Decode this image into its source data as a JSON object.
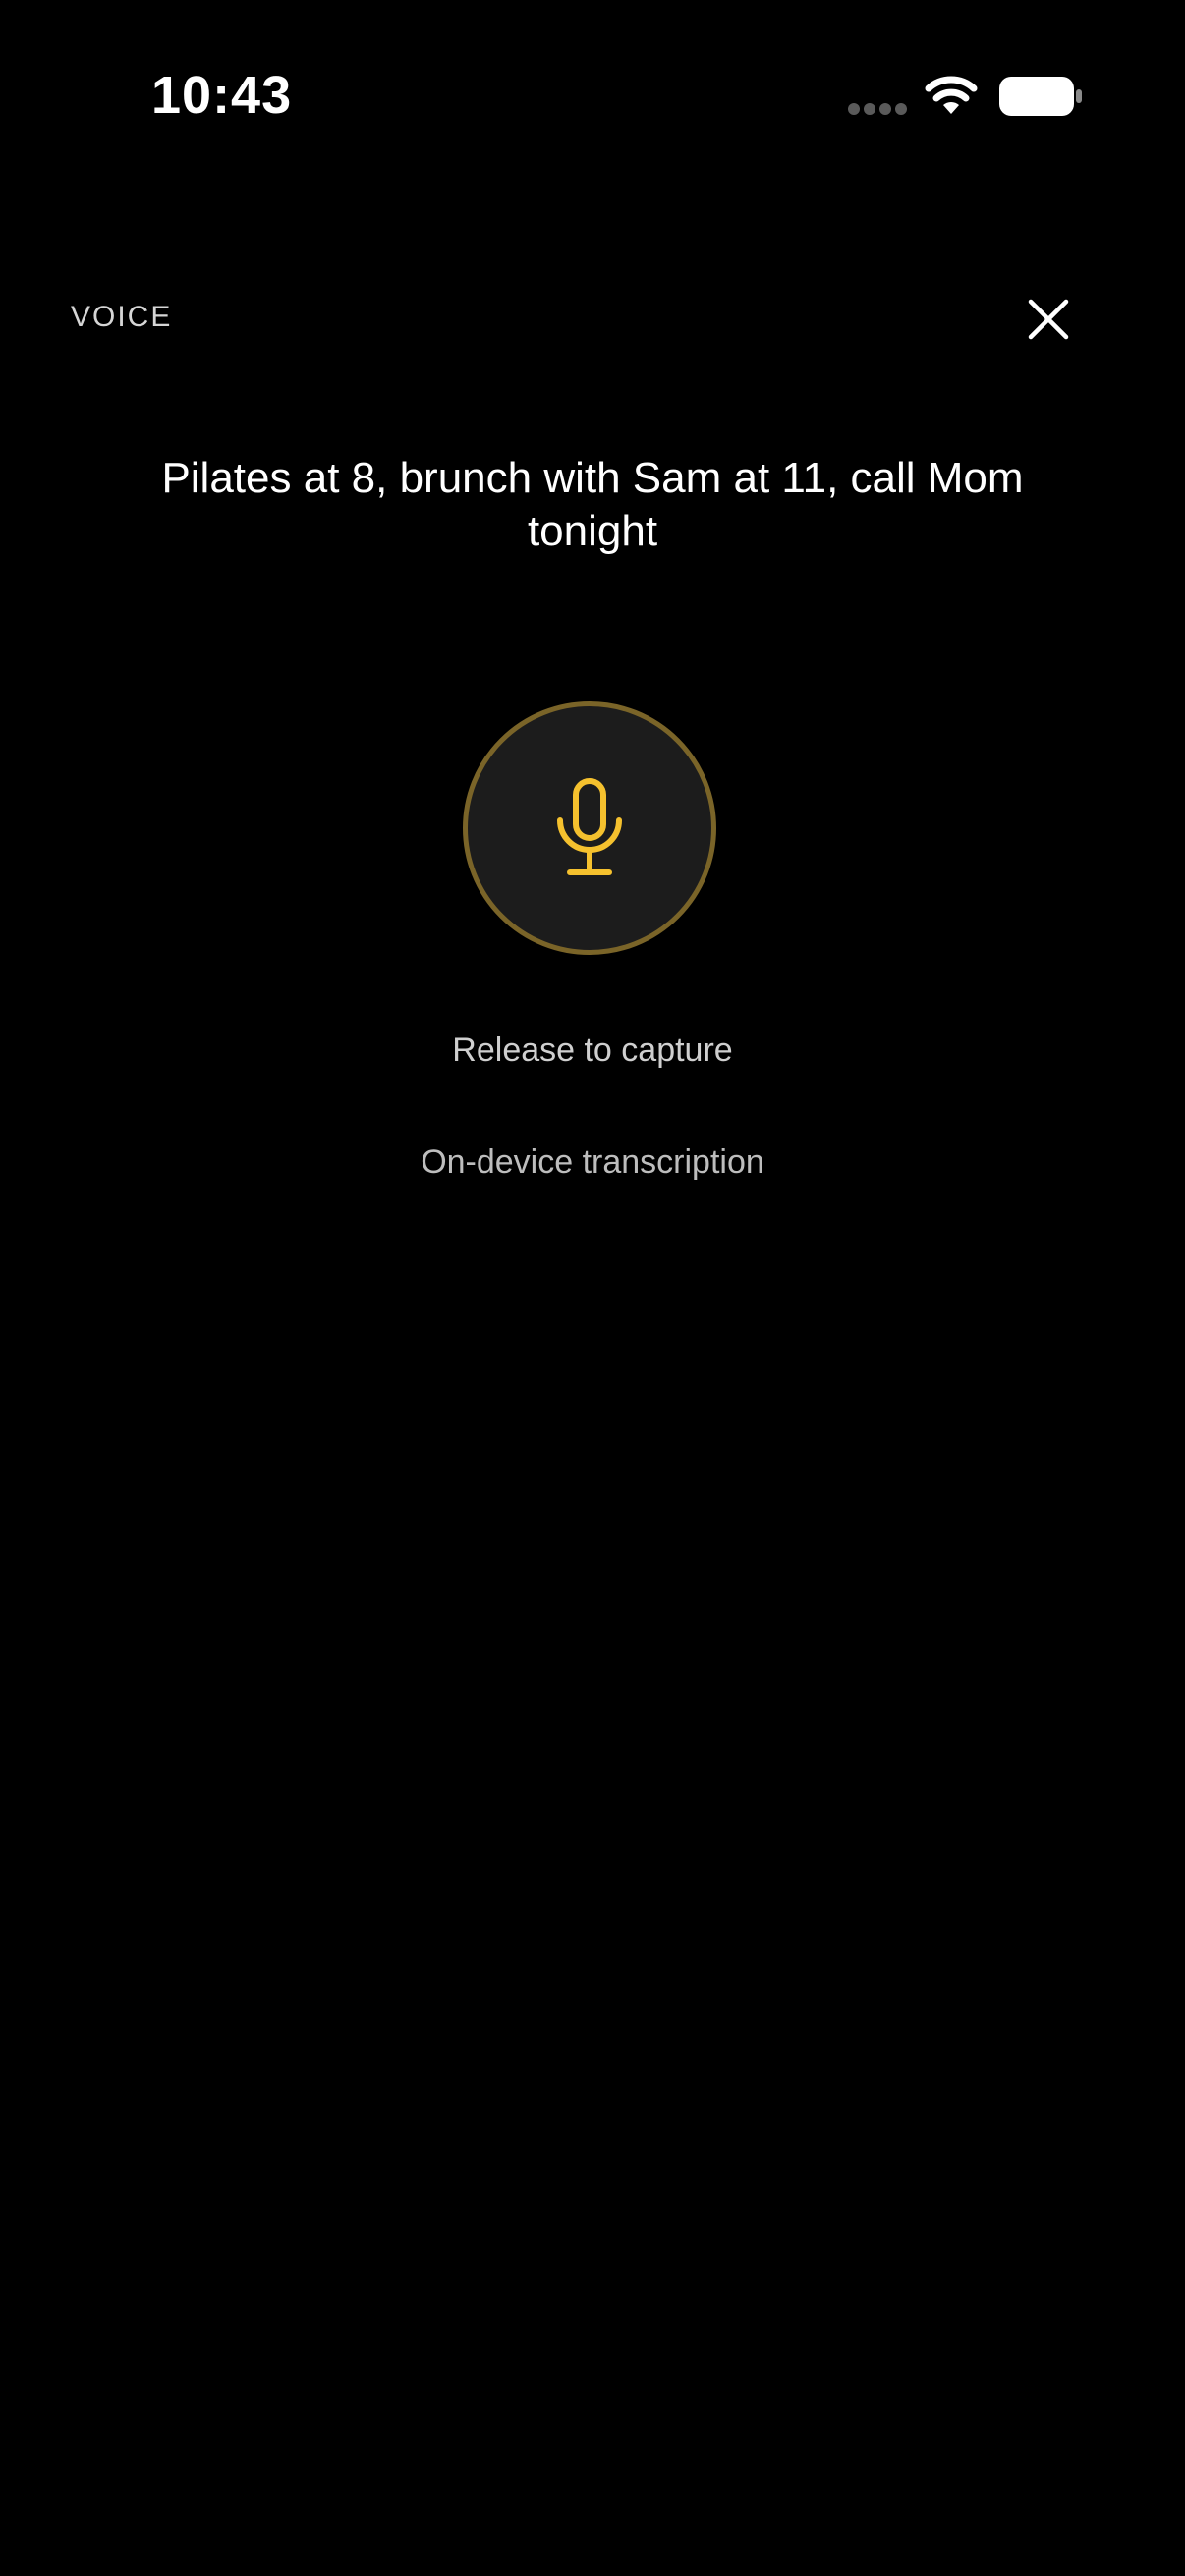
{
  "status_bar": {
    "time": "10:43",
    "icons": [
      "signal-dots-icon",
      "wifi-icon",
      "battery-icon"
    ]
  },
  "header": {
    "section_label": "VOICE",
    "close_icon": "close-icon"
  },
  "transcript": {
    "text": "Pilates at 8, brunch with Sam at 11, call Mom tonight"
  },
  "mic": {
    "icon": "microphone-icon",
    "accent_color": "#f5c12e",
    "ring_color": "#7a6428",
    "state": "listening"
  },
  "hints": {
    "release": "Release to capture",
    "transcription": "On-device transcription"
  }
}
